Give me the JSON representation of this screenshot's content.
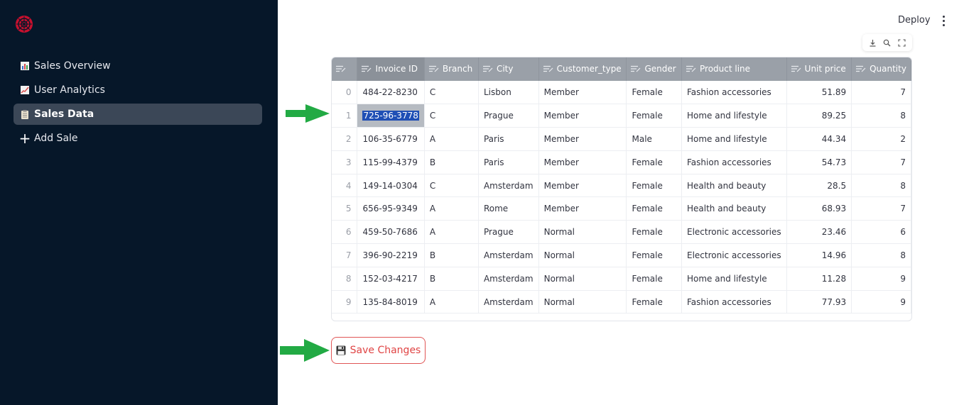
{
  "header": {
    "deploy_label": "Deploy"
  },
  "sidebar": {
    "items": [
      {
        "label": "Sales Overview",
        "icon": "bar-chart-icon",
        "active": false
      },
      {
        "label": "User Analytics",
        "icon": "trend-chart-icon",
        "active": false
      },
      {
        "label": "Sales Data",
        "icon": "clipboard-icon",
        "active": true
      },
      {
        "label": "Add Sale",
        "icon": "plus-icon",
        "active": false
      }
    ]
  },
  "table": {
    "columns": [
      "",
      "Invoice ID",
      "Branch",
      "City",
      "Customer_type",
      "Gender",
      "Product line",
      "Unit price",
      "Quantity"
    ],
    "rows": [
      [
        "0",
        "484-22-8230",
        "C",
        "Lisbon",
        "Member",
        "Female",
        "Fashion accessories",
        "51.89",
        "7"
      ],
      [
        "1",
        "725-96-3778",
        "C",
        "Prague",
        "Member",
        "Female",
        "Home and lifestyle",
        "89.25",
        "8"
      ],
      [
        "2",
        "106-35-6779",
        "A",
        "Paris",
        "Member",
        "Male",
        "Home and lifestyle",
        "44.34",
        "2"
      ],
      [
        "3",
        "115-99-4379",
        "B",
        "Paris",
        "Member",
        "Female",
        "Fashion accessories",
        "54.73",
        "7"
      ],
      [
        "4",
        "149-14-0304",
        "C",
        "Amsterdam",
        "Member",
        "Female",
        "Health and beauty",
        "28.5",
        "8"
      ],
      [
        "5",
        "656-95-9349",
        "A",
        "Rome",
        "Member",
        "Female",
        "Health and beauty",
        "68.93",
        "7"
      ],
      [
        "6",
        "459-50-7686",
        "A",
        "Prague",
        "Normal",
        "Female",
        "Electronic accessories",
        "23.46",
        "6"
      ],
      [
        "7",
        "396-90-2219",
        "B",
        "Amsterdam",
        "Normal",
        "Female",
        "Electronic accessories",
        "14.96",
        "8"
      ],
      [
        "8",
        "152-03-4217",
        "B",
        "Amsterdam",
        "Normal",
        "Female",
        "Home and lifestyle",
        "11.28",
        "9"
      ],
      [
        "9",
        "135-84-8019",
        "A",
        "Amsterdam",
        "Normal",
        "Female",
        "Fashion accessories",
        "77.93",
        "9"
      ]
    ],
    "selected_row": 1,
    "selected_col": 1
  },
  "save_button": {
    "label": "Save Changes"
  },
  "colors": {
    "sidebar_bg": "#061729",
    "accent_red": "#e04444",
    "arrow_green": "#22aa44",
    "selection_blue": "#1f4fb5"
  }
}
